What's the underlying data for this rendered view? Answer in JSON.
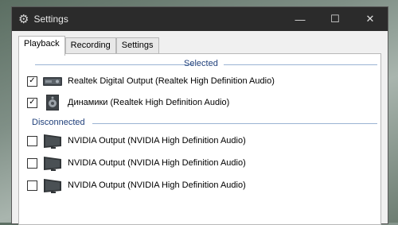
{
  "window": {
    "title": "Settings",
    "controls": {
      "minimize": "—",
      "maximize": "☐",
      "close": "✕"
    }
  },
  "tabs": [
    {
      "label": "Playback",
      "active": true
    },
    {
      "label": "Recording",
      "active": false
    },
    {
      "label": "Settings",
      "active": false
    }
  ],
  "groups": {
    "selected": {
      "label": "Selected",
      "devices": [
        {
          "label": "Realtek Digital Output (Realtek High Definition Audio)",
          "checked": true,
          "icon": "digital-output-icon",
          "mark": "✓"
        },
        {
          "label": "Динамики (Realtek High Definition Audio)",
          "checked": true,
          "icon": "speaker-icon",
          "mark": "✓"
        }
      ]
    },
    "disconnected": {
      "label": "Disconnected",
      "devices": [
        {
          "label": "NVIDIA Output (NVIDIA High Definition Audio)",
          "checked": false,
          "icon": "monitor-icon",
          "mark": ""
        },
        {
          "label": "NVIDIA Output (NVIDIA High Definition Audio)",
          "checked": false,
          "icon": "monitor-icon",
          "mark": ""
        },
        {
          "label": "NVIDIA Output (NVIDIA High Definition Audio)",
          "checked": false,
          "icon": "monitor-icon",
          "mark": ""
        }
      ]
    }
  },
  "colors": {
    "titlebar": "#2b2b2b",
    "group_label": "#1f3f7a",
    "group_line": "#9bb3d3"
  }
}
